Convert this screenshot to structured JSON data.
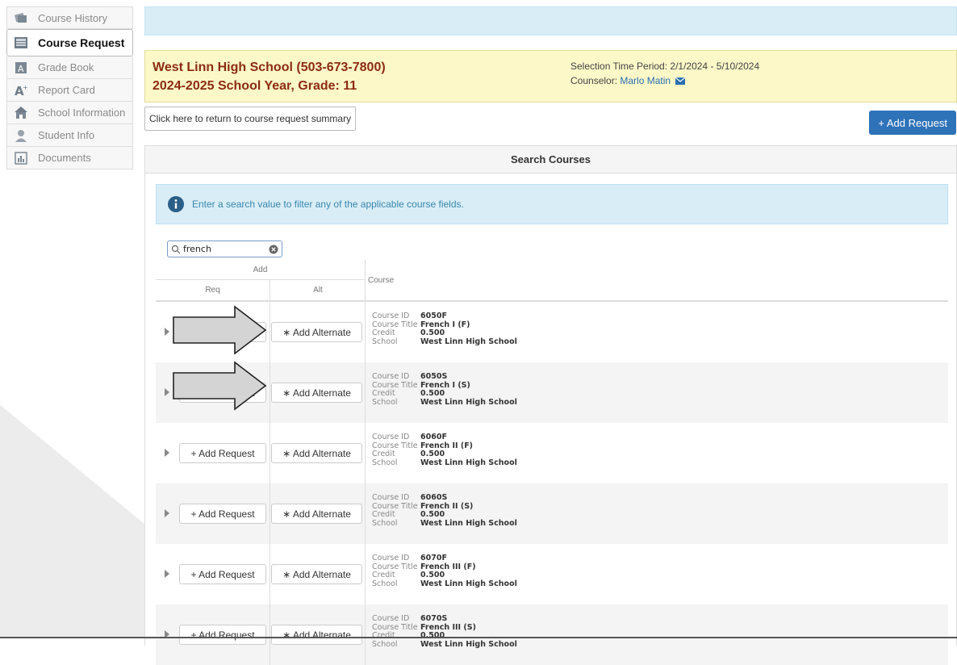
{
  "sidebar": {
    "items": [
      {
        "label": "Course History",
        "icon": "course-history-icon",
        "active": false
      },
      {
        "label": "Course Request",
        "icon": "course-request-icon",
        "active": true
      },
      {
        "label": "Grade Book",
        "icon": "grade-book-icon",
        "active": false
      },
      {
        "label": "Report Card",
        "icon": "report-card-icon",
        "active": false
      },
      {
        "label": "School Information",
        "icon": "school-icon",
        "active": false
      },
      {
        "label": "Student Info",
        "icon": "student-icon",
        "active": false
      },
      {
        "label": "Documents",
        "icon": "documents-icon",
        "active": false
      }
    ]
  },
  "school": {
    "name": "West Linn High School (503-673-7800)",
    "year": "2024-2025 School Year, Grade: 11",
    "selection_period": "Selection Time Period: 2/1/2024 - 5/10/2024",
    "counselor_label": "Counselor:",
    "counselor_name": "Marlo Matin"
  },
  "actions": {
    "return_label": "Click here to return to course request summary",
    "add_request_label": "+ Add Request"
  },
  "search": {
    "panel_title": "Search Courses",
    "info_text": "Enter a search value to filter any of the applicable course fields.",
    "value": "french"
  },
  "table": {
    "headers": {
      "add": "Add",
      "req": "Req",
      "alt": "Alt",
      "course": "Course"
    },
    "field_labels": {
      "id": "Course ID",
      "title": "Course Title",
      "credit": "Credit",
      "school": "School"
    },
    "add_request_label": "+ Add Request",
    "add_alternate_label": "∗ Add Alternate",
    "rows": [
      {
        "id": "6050F",
        "title": "French I (F)",
        "credit": "0.500",
        "school": "West Linn High School"
      },
      {
        "id": "6050S",
        "title": "French I (S)",
        "credit": "0.500",
        "school": "West Linn High School"
      },
      {
        "id": "6060F",
        "title": "French II (F)",
        "credit": "0.500",
        "school": "West Linn High School"
      },
      {
        "id": "6060S",
        "title": "French II (S)",
        "credit": "0.500",
        "school": "West Linn High School"
      },
      {
        "id": "6070F",
        "title": "French III (F)",
        "credit": "0.500",
        "school": "West Linn High School"
      },
      {
        "id": "6070S",
        "title": "French III (S)",
        "credit": "0.500",
        "school": "West Linn High School"
      }
    ]
  },
  "colors": {
    "accent": "#2e72b8",
    "school_text": "#8b2b12",
    "banner_bg": "#d9edf7",
    "school_bg": "#fcf8c8"
  }
}
